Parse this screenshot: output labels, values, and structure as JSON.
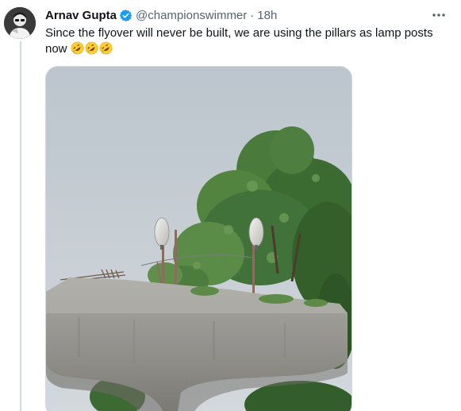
{
  "author": {
    "display_name": "Arnav Gupta",
    "handle": "@championswimmer",
    "separator": "·",
    "time_ago": "18h",
    "verified": true
  },
  "tweet": {
    "text": "Since the flyover will never be built, we are using the pillars as lamp posts now",
    "emojis": [
      "rolling-on-floor-laughing",
      "rolling-on-floor-laughing",
      "rolling-on-floor-laughing"
    ]
  },
  "colors": {
    "verified_badge": "#1d9bf0",
    "secondary_text": "#536471",
    "primary_text": "#0f1419"
  },
  "icons": {
    "more": "more-horizontal-icon",
    "verified": "verified-badge-icon"
  }
}
